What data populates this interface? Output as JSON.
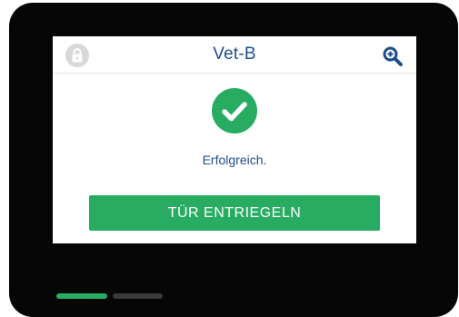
{
  "header": {
    "title": "Vet-B",
    "lock_icon": "lock-icon",
    "zoom_icon": "zoom-in-icon"
  },
  "status": {
    "icon": "check-circle-icon",
    "message": "Erfolgreich."
  },
  "actions": {
    "unlock_label": "TÜR ENTRIEGELN"
  },
  "pagination": {
    "current_page": 1,
    "total_pages": 2
  },
  "colors": {
    "accent_green": "#27ac62",
    "title_blue": "#1f4e8c",
    "frame_black": "#060606",
    "lock_gray": "#d8d8d8",
    "inactive_page": "#3a3a3a"
  }
}
